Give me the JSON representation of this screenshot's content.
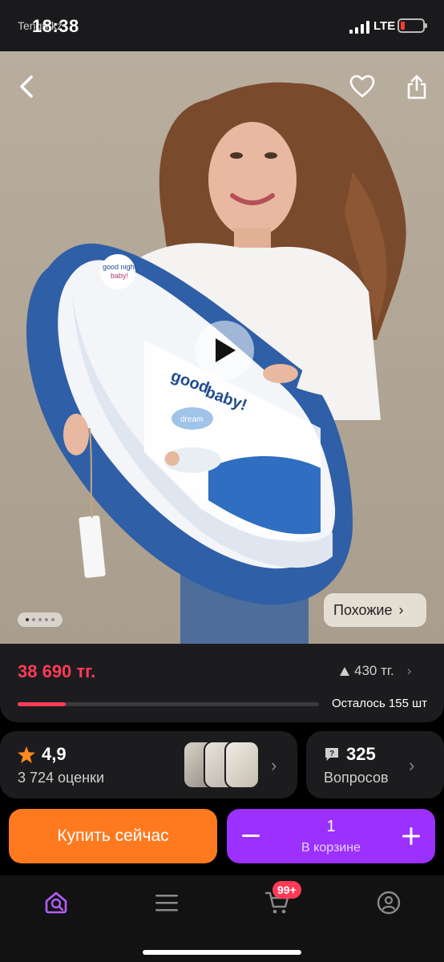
{
  "status_bar": {
    "time": "18:38",
    "network": "LTE",
    "overlay_text": "Tengri kz",
    "battery_level": 0.15
  },
  "hero": {
    "similar_label": "Похожие",
    "carousel_total": 5,
    "carousel_active": 1,
    "product_print": {
      "brand_top": "good night baby!",
      "dream_label": "dream"
    }
  },
  "price": {
    "current": "38 690 тг.",
    "drop": "430 тг.",
    "stock_text": "Осталось 155 шт",
    "stock_fraction": 0.16,
    "accent_color": "#ff3b57"
  },
  "rating": {
    "value": "4,9",
    "count_label": "3 724 оценки"
  },
  "questions": {
    "count": "325",
    "label": "Вопросов"
  },
  "actions": {
    "buy_now": "Купить сейчас",
    "cart_quantity": "1",
    "in_cart_label": "В корзине",
    "buy_color": "#ff7a1f",
    "cart_color": "#9b30ff"
  },
  "nav": {
    "items": [
      "home-search-icon",
      "catalog-icon",
      "cart-icon",
      "profile-icon"
    ],
    "cart_badge": "99+"
  }
}
